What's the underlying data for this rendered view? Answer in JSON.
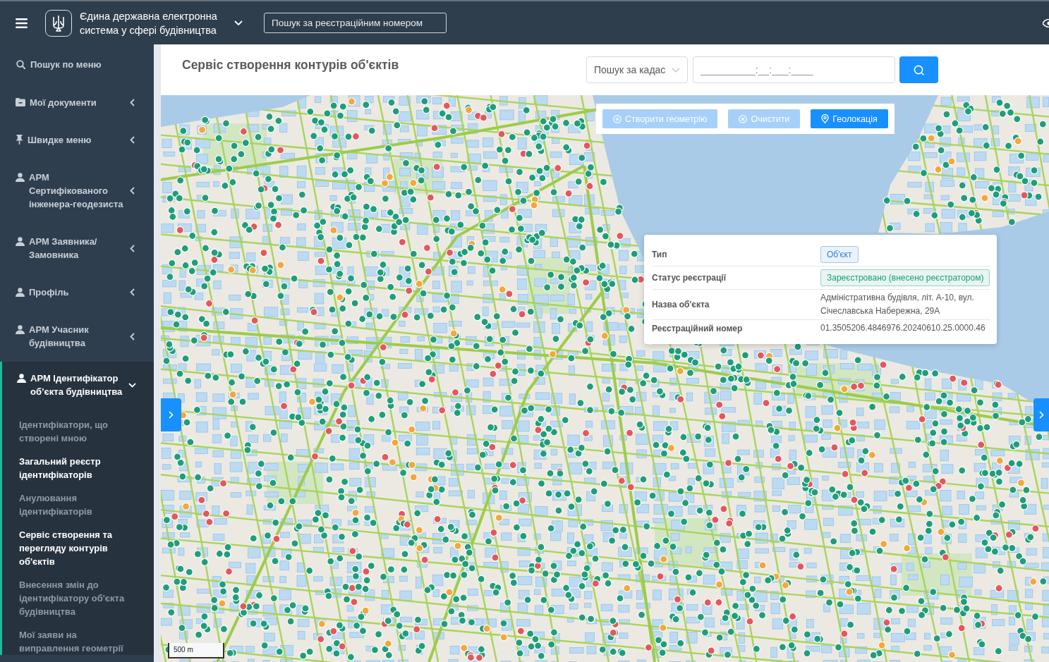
{
  "header": {
    "title": "Єдина державна електронна система у сфері будівництва",
    "search": {
      "placeholder": "Пошук за реєстраційним номером"
    }
  },
  "sidebar": {
    "search": {
      "placeholder": "Пошук по меню"
    },
    "items": [
      {
        "label": "Мої документи",
        "kind": "documents",
        "expanded": false
      },
      {
        "label": "Швидке меню",
        "kind": "shortcuts",
        "expanded": false
      },
      {
        "label": "АРМ Сертифікованого інженера-геодезиста",
        "kind": "role",
        "expanded": false
      },
      {
        "label": "АРМ Заявника/ Замовника",
        "kind": "role",
        "expanded": false
      },
      {
        "label": "Профіль",
        "kind": "profile",
        "expanded": false
      },
      {
        "label": "АРМ Учасник будівництва",
        "kind": "role",
        "expanded": false
      },
      {
        "label": "АРМ Ідентифікатор об’єкта будівництва",
        "kind": "role",
        "expanded": true,
        "children": [
          {
            "label": "Ідентифікатори, що створені мною",
            "selected": false
          },
          {
            "label": "Загальний реєстр ідентифікаторів",
            "selected": true
          },
          {
            "label": "Анулювання ідентифікаторів",
            "selected": false
          },
          {
            "label": "Сервіс створення та перегляду контурів об'єктів",
            "selected": true
          },
          {
            "label": "Внесення змін до ідентифікатору об'єкта будівництва",
            "selected": false
          },
          {
            "label": "Мої заяви на виправлення геометрії",
            "selected": false
          }
        ]
      }
    ]
  },
  "page": {
    "title": "Сервіс створення контурів об'єктів",
    "search_type": {
      "value": "Пошук за кадас"
    },
    "cadastral_number": {
      "placeholder": "__________:__:___:____"
    }
  },
  "map": {
    "toolbar": [
      {
        "label": "Створити геометрію",
        "kind": "create",
        "disabled": true
      },
      {
        "label": "Очистити",
        "kind": "clear",
        "disabled": true
      },
      {
        "label": "Геолокація",
        "kind": "geolocate",
        "disabled": false
      }
    ],
    "popup": {
      "rows": [
        {
          "label": "Тип",
          "kind": "badge",
          "value": "Об'єкт",
          "color": "#2f80d6"
        },
        {
          "label": "Статус реєстрації",
          "kind": "badge",
          "value": "Зареєстровано (внесено реєстратором)",
          "color": "#1a9e78"
        },
        {
          "label": "Назва об'єкта",
          "kind": "text",
          "value": "Адміністративна будівля, літ. А-10, вул. Січеславська Набережна, 29А"
        },
        {
          "label": "Реєстраційний номер",
          "kind": "text",
          "value": "01.3505206.4846976.20240610.25.0000.46"
        }
      ]
    },
    "scale": "500 m"
  }
}
